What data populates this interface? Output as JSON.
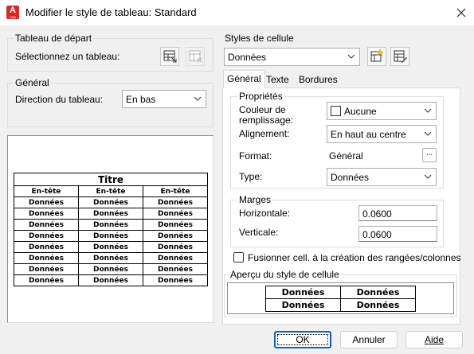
{
  "window": {
    "title": "Modifier le style de tableau: Standard",
    "app_icon_letter": "A",
    "app_icon_sub": "CAD"
  },
  "start_table": {
    "legend": "Tableau de départ",
    "select_label": "Sélectionnez un tableau:"
  },
  "general": {
    "legend": "Général",
    "direction_label": "Direction du tableau:",
    "direction_value": "En bas"
  },
  "table_preview": {
    "title": "Titre",
    "headers": [
      "En-tête",
      "En-tête",
      "En-tête"
    ],
    "rows": [
      [
        "Données",
        "Données",
        "Données"
      ],
      [
        "Données",
        "Données",
        "Données"
      ],
      [
        "Données",
        "Données",
        "Données"
      ],
      [
        "Données",
        "Données",
        "Données"
      ],
      [
        "Données",
        "Données",
        "Données"
      ],
      [
        "Données",
        "Données",
        "Données"
      ],
      [
        "Données",
        "Données",
        "Données"
      ],
      [
        "Données",
        "Données",
        "Données"
      ]
    ]
  },
  "cell_styles": {
    "legend": "Styles de cellule",
    "selected": "Données",
    "tabs": [
      "Général",
      "Texte",
      "Bordures"
    ],
    "active_tab": 0
  },
  "properties": {
    "legend": "Propriétés",
    "fill_label": "Couleur de remplissage:",
    "fill_value": "Aucune",
    "align_label": "Alignement:",
    "align_value": "En haut au centre",
    "format_label": "Format:",
    "format_value": "Général",
    "format_button": "...",
    "type_label": "Type:",
    "type_value": "Données"
  },
  "margins": {
    "legend": "Marges",
    "horizontal_label": "Horizontale:",
    "horizontal_value": "0.0600",
    "vertical_label": "Verticale:",
    "vertical_value": "0.0600"
  },
  "merge": {
    "label": "Fusionner cell. à la création des rangées/colonnes",
    "checked": false
  },
  "cell_preview": {
    "legend": "Aperçu du style de cellule",
    "rows": [
      [
        "Données",
        "Données"
      ],
      [
        "Données",
        "Données"
      ]
    ]
  },
  "buttons": {
    "ok": "OK",
    "cancel": "Annuler",
    "help": "Aide"
  }
}
